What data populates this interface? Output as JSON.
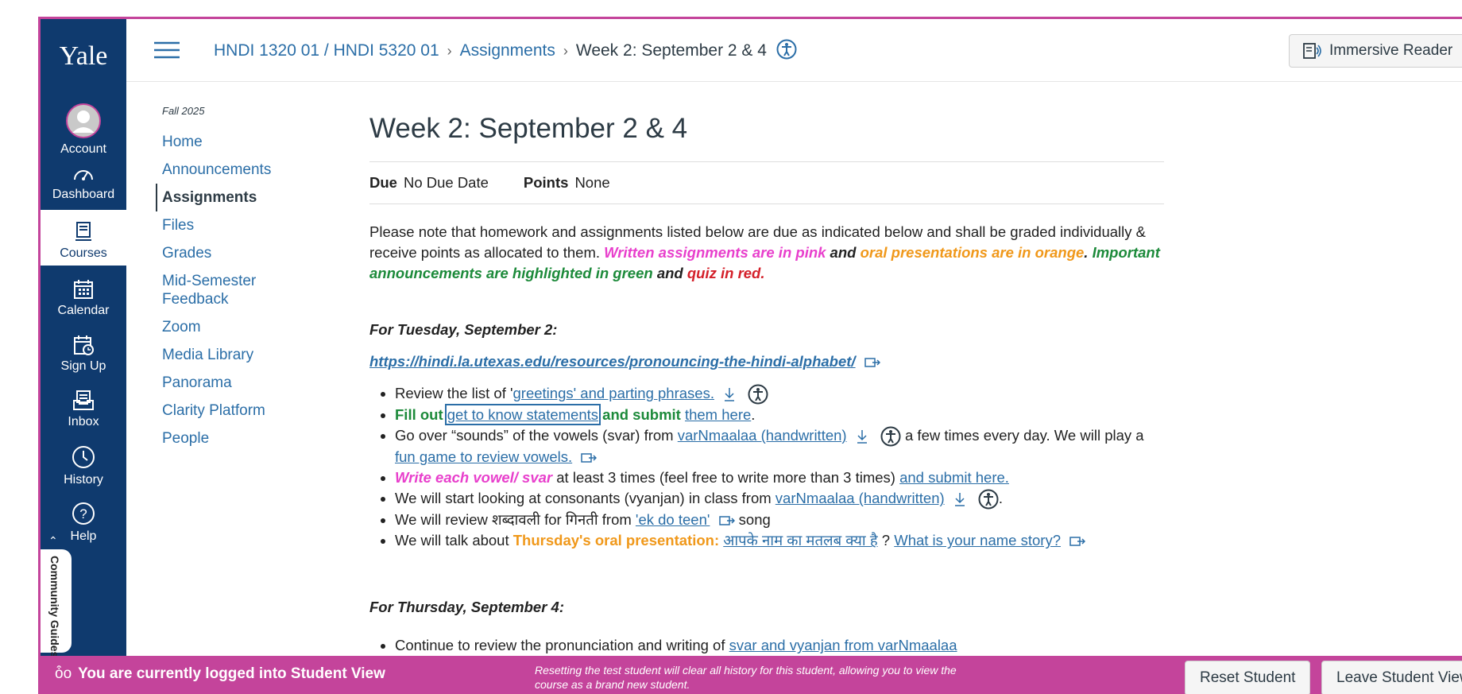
{
  "global_nav": {
    "logo": "Yale",
    "items": [
      {
        "label": "Account",
        "icon": "avatar-icon"
      },
      {
        "label": "Dashboard",
        "icon": "dashboard-icon"
      },
      {
        "label": "Courses",
        "icon": "courses-icon"
      },
      {
        "label": "Calendar",
        "icon": "calendar-icon"
      },
      {
        "label": "Sign Up",
        "icon": "sign-up-icon"
      },
      {
        "label": "Inbox",
        "icon": "inbox-icon"
      },
      {
        "label": "History",
        "icon": "history-icon"
      },
      {
        "label": "Help",
        "icon": "help-icon"
      }
    ],
    "community": "Community Guides"
  },
  "breadcrumb": {
    "course": "HNDI 1320 01 / HNDI 5320 01",
    "section": "Assignments",
    "current": "Week 2: September 2 & 4"
  },
  "immersive_reader": "Immersive Reader",
  "course_nav": {
    "term": "Fall 2025",
    "items": [
      "Home",
      "Announcements",
      "Assignments",
      "Files",
      "Grades",
      "Mid-Semester Feedback",
      "Zoom",
      "Media Library",
      "Panorama",
      "Clarity Platform",
      "People"
    ]
  },
  "assignment": {
    "title": "Week 2: September 2 & 4",
    "due_label": "Due",
    "due_value": "No Due Date",
    "points_label": "Points",
    "points_value": "None",
    "intro": {
      "p1": "Please note that homework and assignments listed below are due as indicated below and shall be graded individually & receive points as allocated to them. ",
      "pink": "Written assignments are in pink",
      "and1": " and ",
      "orange": "oral presentations are in orange",
      "dot": ". ",
      "green": "Important announcements are highlighted in green",
      "and2": " and ",
      "red": "quiz in red."
    },
    "tuesday_heading": "For Tuesday, September 2:",
    "tuesday_url": "https://hindi.la.utexas.edu/resources/pronouncing-the-hindi-alphabet/",
    "items": {
      "i1_a": "Review the list of '",
      "i1_link": "greetings' and parting phrases.",
      "i2_fill": "Fill out",
      "i2_link": "get to know statements",
      "i2_submit": " and submit ",
      "i2_link2": "them here",
      "i2_end": ".",
      "i3_a": "Go over “sounds” of the vowels (svar) from ",
      "i3_link": "varNmaalaa (handwritten)",
      "i3_b": " a few times every day. We will play a ",
      "i3_link2": "fun game to review vowels.",
      "i4_pink": "Write each vowel/ svar",
      "i4_a": " at least 3 times (feel free to write more than 3 times) ",
      "i4_link": "and submit here.",
      "i5_a": "We will start looking at consonants (vyanjan) in class from ",
      "i5_link": "varNmaalaa (handwritten)",
      "i5_end": ".",
      "i6_a": "We will review शब्दावली for गिनती from ",
      "i6_link": "'ek do teen'",
      "i6_b": " song",
      "i7_a": "We will talk about ",
      "i7_orange": "Thursday's oral presentation",
      "i7_colon": ": ",
      "i7_link": "आपके नाम का मतलब क्या है",
      "i7_q": " ? ",
      "i7_link2": "What is your name story?"
    },
    "thursday_heading": "For Thursday, September 4:",
    "thursday_item_a": "Continue to review the pronunciation and writing of ",
    "thursday_item_link": "svar and vyanjan from varNmaalaa"
  },
  "student_view": {
    "message": "You are currently logged into Student View",
    "note": "Resetting the test student will clear all history for this student, allowing you to view the course as a brand new student.",
    "reset_button": "Reset Student",
    "leave_button": "Leave Student View"
  },
  "colors": {
    "nav": "#0f3a6e",
    "bar": "#c4449b",
    "link": "#2b6ea7",
    "pink": "#e83fcc",
    "orange": "#f0981a",
    "green": "#1c8a3a",
    "red": "#d4202a"
  }
}
